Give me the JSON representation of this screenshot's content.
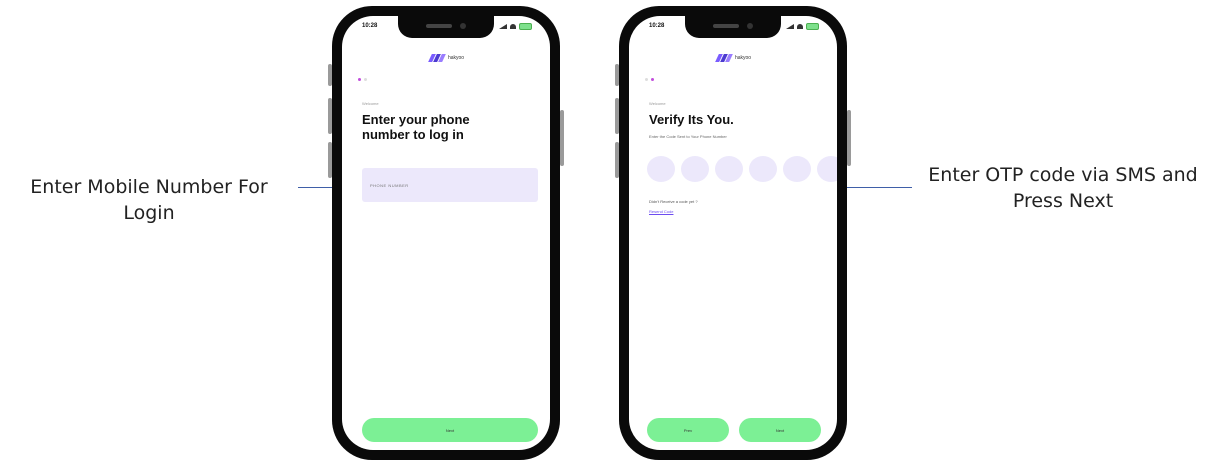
{
  "annotations": {
    "left": "Enter Mobile Number For Login",
    "right": "Enter OTP code via SMS and Press Next"
  },
  "colors": {
    "accent": "#6d4cf0",
    "button": "#7cf095",
    "input_bg": "#ece8fb",
    "arrow": "#3f5fa8"
  },
  "login_screen": {
    "status_time": "10:28",
    "brand_name": "hakyoo",
    "eyebrow": "Welcome",
    "title": "Enter your phone number to log in",
    "phone_placeholder": "PHONE NUMBER",
    "next_label": "Next"
  },
  "otp_screen": {
    "status_time": "10:28",
    "brand_name": "hakyoo",
    "eyebrow": "Welcome",
    "title": "Verify Its You.",
    "subtitle": "Enter the Code Sent to Your Phone Number",
    "otp_digits": [
      "",
      "",
      "",
      "",
      "",
      ""
    ],
    "resend_question": "Didn't Receive a code yet ?",
    "resend_link": "Resend Code",
    "prev_label": "Prev",
    "next_label": "Next"
  }
}
